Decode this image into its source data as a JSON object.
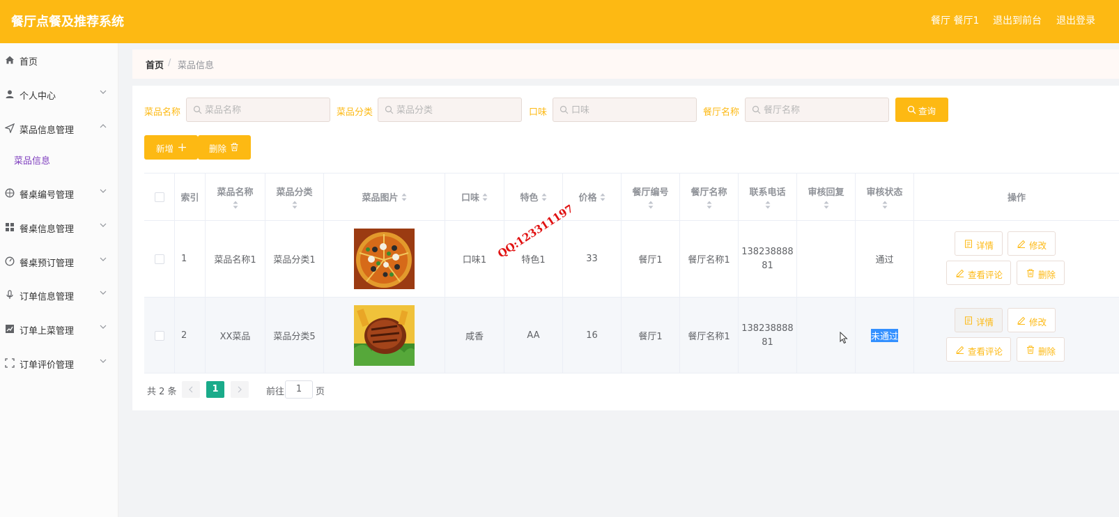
{
  "header": {
    "title": "餐厅点餐及推荐系统",
    "user": "餐厅 餐厅1",
    "to_front": "退出到前台",
    "logout": "退出登录"
  },
  "sidebar": {
    "items": [
      {
        "label": "首页",
        "icon": "home-icon"
      },
      {
        "label": "个人中心",
        "icon": "user-icon"
      },
      {
        "label": "菜品信息管理",
        "icon": "send-icon"
      },
      {
        "label": "餐桌编号管理",
        "icon": "compass-icon"
      },
      {
        "label": "餐桌信息管理",
        "icon": "grid-icon"
      },
      {
        "label": "餐桌预订管理",
        "icon": "gauge-icon"
      },
      {
        "label": "订单信息管理",
        "icon": "microphone-icon"
      },
      {
        "label": "订单上菜管理",
        "icon": "chart-icon"
      },
      {
        "label": "订单评价管理",
        "icon": "fullscreen-icon"
      }
    ],
    "sub_active": "菜品信息"
  },
  "breadcrumb": {
    "home": "首页",
    "sep": "/",
    "current": "菜品信息"
  },
  "filters": [
    {
      "label": "菜品名称",
      "placeholder": "菜品名称"
    },
    {
      "label": "菜品分类",
      "placeholder": "菜品分类"
    },
    {
      "label": "口味",
      "placeholder": "口味"
    },
    {
      "label": "餐厅名称",
      "placeholder": "餐厅名称"
    }
  ],
  "buttons": {
    "query": "查询",
    "add": "新增",
    "delete": "删除"
  },
  "table": {
    "headers": [
      "索引",
      "菜品名称",
      "菜品分类",
      "菜品图片",
      "口味",
      "特色",
      "价格",
      "餐厅编号",
      "餐厅名称",
      "联系电话",
      "审核回复",
      "审核状态",
      "操作"
    ],
    "rows": [
      {
        "index": "1",
        "name": "菜品名称1",
        "category": "菜品分类1",
        "image": "pizza",
        "taste": "口味1",
        "feature": "特色1",
        "price": "33",
        "rest_no": "餐厅1",
        "rest_name": "餐厅名称1",
        "phone_a": "138238888",
        "phone_b": "81",
        "reply": "",
        "status": "通过"
      },
      {
        "index": "2",
        "name": "XX菜品",
        "category": "菜品分类5",
        "image": "steak",
        "taste": "咸香",
        "feature": "AA",
        "price": "16",
        "rest_no": "餐厅1",
        "rest_name": "餐厅名称1",
        "phone_a": "138238888",
        "phone_b": "81",
        "reply": "",
        "status": "未通过"
      }
    ],
    "actions": {
      "detail": "详情",
      "edit": "修改",
      "comments": "查看评论",
      "delete": "删除"
    }
  },
  "pagination": {
    "total": "共 2 条",
    "page": "1",
    "goto": "前往",
    "goto_value": "1",
    "unit": "页"
  },
  "watermark": "QQ:123311197",
  "colors": {
    "accent": "#fdb913",
    "active_sub": "#7f3fbf",
    "page_active": "#1aab8a"
  }
}
